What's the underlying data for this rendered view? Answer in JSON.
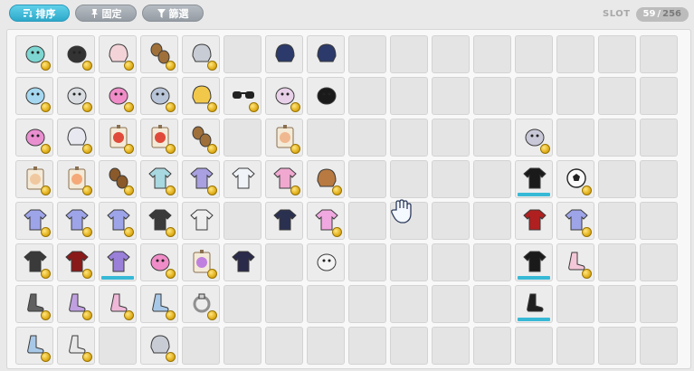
{
  "toolbar": {
    "sort_label": "排序",
    "pin_label": "固定",
    "filter_label": "篩選",
    "active_button": "sort"
  },
  "slot_counter": {
    "label": "SLOT",
    "used": "59",
    "separator": "/",
    "max": "256"
  },
  "colors": {
    "accent": "#33b0d0",
    "button_gray": "#a3a9b0",
    "slot_bg": "#e4e4e4",
    "coin": "#e2b01c",
    "bar": "#37b9d6"
  },
  "grid": {
    "columns": 16,
    "rows": 8,
    "filled_slots": [
      {
        "r": 0,
        "c": 0,
        "icon": "teal-pet-icon",
        "color": "#7ed6d2",
        "coin": true
      },
      {
        "r": 0,
        "c": 1,
        "icon": "black-pet-icon",
        "color": "#333333",
        "coin": true
      },
      {
        "r": 0,
        "c": 2,
        "icon": "bunny-ears-icon",
        "color": "#f3d3d8",
        "coin": true
      },
      {
        "r": 0,
        "c": 3,
        "icon": "barrel-stack-icon",
        "color": "#a0703a",
        "coin": true
      },
      {
        "r": 0,
        "c": 4,
        "icon": "silver-helmet-icon",
        "color": "#c8ccd4",
        "coin": true
      },
      {
        "r": 0,
        "c": 6,
        "icon": "dark-cat-mask-icon",
        "color": "#2b3a6a",
        "coin": false
      },
      {
        "r": 0,
        "c": 7,
        "icon": "dark-cat-mask-icon",
        "color": "#2b3a6a",
        "coin": false
      },
      {
        "r": 1,
        "c": 0,
        "icon": "blue-sparkle-icon",
        "color": "#a5d8f0",
        "coin": true
      },
      {
        "r": 1,
        "c": 1,
        "icon": "fish-icon",
        "color": "#d9dce0",
        "coin": true
      },
      {
        "r": 1,
        "c": 2,
        "icon": "pink-bell-icon",
        "color": "#f08cc8",
        "coin": true
      },
      {
        "r": 1,
        "c": 3,
        "icon": "silver-wings-icon",
        "color": "#b8c4d8",
        "coin": true
      },
      {
        "r": 1,
        "c": 4,
        "icon": "blonde-hair-icon",
        "color": "#f2c84a",
        "coin": true
      },
      {
        "r": 1,
        "c": 5,
        "icon": "sunglasses-icon",
        "color": "#222222",
        "coin": true
      },
      {
        "r": 1,
        "c": 6,
        "icon": "card-icon",
        "color": "#e8d0e8",
        "coin": true
      },
      {
        "r": 1,
        "c": 7,
        "icon": "black-cat-icon",
        "color": "#1a1a1a",
        "coin": false
      },
      {
        "r": 2,
        "c": 0,
        "icon": "pink-bear-icon",
        "color": "#e98fd0",
        "coin": true
      },
      {
        "r": 2,
        "c": 1,
        "icon": "white-hair-icon",
        "color": "#e8e8f0",
        "coin": true
      },
      {
        "r": 2,
        "c": 2,
        "icon": "red-tag-icon",
        "color": "#e04a3a",
        "coin": true
      },
      {
        "r": 2,
        "c": 3,
        "icon": "red-tag-icon",
        "color": "#e04a3a",
        "coin": true
      },
      {
        "r": 2,
        "c": 4,
        "icon": "barrel-stack-icon",
        "color": "#a0703a",
        "coin": true
      },
      {
        "r": 2,
        "c": 6,
        "icon": "face-tag-icon",
        "color": "#f0b890",
        "coin": true
      },
      {
        "r": 2,
        "c": 12,
        "icon": "robot-pet-icon",
        "color": "#c8c8d8",
        "coin": true
      },
      {
        "r": 3,
        "c": 0,
        "icon": "face-tag-icon",
        "color": "#f0c8a0",
        "coin": true
      },
      {
        "r": 3,
        "c": 1,
        "icon": "face-tag-icon",
        "color": "#f5a878",
        "coin": true
      },
      {
        "r": 3,
        "c": 2,
        "icon": "barrel-stack-icon",
        "color": "#8a5a2a",
        "coin": true
      },
      {
        "r": 3,
        "c": 3,
        "icon": "teal-robe-icon",
        "color": "#a8d8e0",
        "coin": true
      },
      {
        "r": 3,
        "c": 4,
        "icon": "lavender-top-icon",
        "color": "#a8a0e0",
        "coin": true
      },
      {
        "r": 3,
        "c": 5,
        "icon": "white-top-icon",
        "color": "#f0f4f8",
        "coin": false
      },
      {
        "r": 3,
        "c": 6,
        "icon": "pink-shirt-icon",
        "color": "#f0a8d0",
        "coin": true
      },
      {
        "r": 3,
        "c": 7,
        "icon": "brown-hat-icon",
        "color": "#b87a40",
        "coin": true
      },
      {
        "r": 3,
        "c": 12,
        "icon": "black-hood-icon",
        "color": "#1a1a1a",
        "coin": false,
        "bar": true
      },
      {
        "r": 3,
        "c": 13,
        "icon": "soccer-ball-icon",
        "color": "#f8f8f8",
        "coin": true
      },
      {
        "r": 4,
        "c": 0,
        "icon": "lavender-top-icon",
        "color": "#9ea4e8",
        "coin": true
      },
      {
        "r": 4,
        "c": 1,
        "icon": "lavender-top-icon",
        "color": "#9ea4e8",
        "coin": true
      },
      {
        "r": 4,
        "c": 2,
        "icon": "lavender-top-icon",
        "color": "#9ea4e8",
        "coin": true
      },
      {
        "r": 4,
        "c": 3,
        "icon": "black-white-top-icon",
        "color": "#3a3a3a",
        "coin": true
      },
      {
        "r": 4,
        "c": 4,
        "icon": "white-cape-icon",
        "color": "#eeeeee",
        "coin": false
      },
      {
        "r": 4,
        "c": 6,
        "icon": "navy-coat-icon",
        "color": "#2a3050",
        "coin": false
      },
      {
        "r": 4,
        "c": 7,
        "icon": "pink-bunny-top-icon",
        "color": "#f0a8e0",
        "coin": true
      },
      {
        "r": 4,
        "c": 12,
        "icon": "red-hood-icon",
        "color": "#b02020",
        "coin": false
      },
      {
        "r": 4,
        "c": 13,
        "icon": "lavender-top-icon",
        "color": "#9ea4e8",
        "coin": true
      },
      {
        "r": 5,
        "c": 0,
        "icon": "black-white-top-icon",
        "color": "#3a3a3a",
        "coin": true
      },
      {
        "r": 5,
        "c": 1,
        "icon": "red-black-armor-icon",
        "color": "#8a1a1a",
        "coin": true
      },
      {
        "r": 5,
        "c": 2,
        "icon": "purple-dress-icon",
        "color": "#9a80d8",
        "coin": false,
        "bar": true
      },
      {
        "r": 5,
        "c": 3,
        "icon": "pink-bell-icon",
        "color": "#f08cc8",
        "coin": true
      },
      {
        "r": 5,
        "c": 4,
        "icon": "face-tag-icon",
        "color": "#c080e0",
        "coin": true
      },
      {
        "r": 5,
        "c": 5,
        "icon": "dark-armor-icon",
        "color": "#2a2a4a",
        "coin": false
      },
      {
        "r": 5,
        "c": 7,
        "icon": "white-shard-icon",
        "color": "#f4f4f4",
        "coin": false
      },
      {
        "r": 5,
        "c": 12,
        "icon": "black-suit-icon",
        "color": "#1a1a1a",
        "coin": false,
        "bar": true
      },
      {
        "r": 5,
        "c": 13,
        "icon": "pink-shoes-icon",
        "color": "#f4c8d8",
        "coin": true
      },
      {
        "r": 6,
        "c": 0,
        "icon": "gray-shoes-icon",
        "color": "#606060",
        "coin": true
      },
      {
        "r": 6,
        "c": 1,
        "icon": "purple-boots-icon",
        "color": "#c0a0e0",
        "coin": true
      },
      {
        "r": 6,
        "c": 2,
        "icon": "pink-shoes-icon",
        "color": "#f0b8d8",
        "coin": true
      },
      {
        "r": 6,
        "c": 3,
        "icon": "blue-shoes-icon",
        "color": "#a8c8e8",
        "coin": true
      },
      {
        "r": 6,
        "c": 4,
        "icon": "silver-ring-icon",
        "color": "#909090",
        "coin": true
      },
      {
        "r": 6,
        "c": 12,
        "icon": "black-boots-icon",
        "color": "#202020",
        "coin": false,
        "bar": true
      },
      {
        "r": 7,
        "c": 0,
        "icon": "blue-shoes-icon",
        "color": "#a8c8e8",
        "coin": true
      },
      {
        "r": 7,
        "c": 1,
        "icon": "white-boots-icon",
        "color": "#e8e8e8",
        "coin": true
      },
      {
        "r": 7,
        "c": 3,
        "icon": "silver-helmet-icon",
        "color": "#c8ccd4",
        "coin": true
      }
    ]
  }
}
